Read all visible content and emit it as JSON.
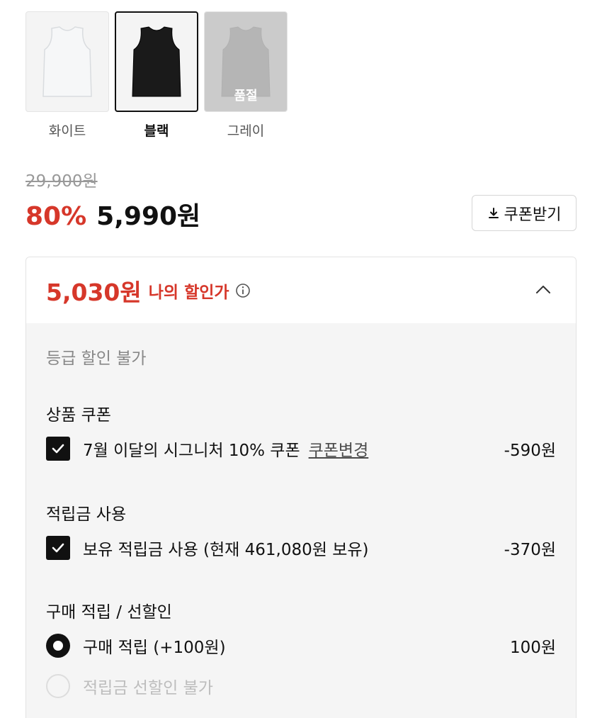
{
  "colors": {
    "accent_red": "#d6372a",
    "text_dark": "#111111",
    "panel_bg": "#f5f5f5"
  },
  "swatches": [
    {
      "label": "화이트",
      "color": "#f6f7f8",
      "selected": false,
      "sold_out": false
    },
    {
      "label": "블랙",
      "color": "#1a1a1a",
      "selected": true,
      "sold_out": false
    },
    {
      "label": "그레이",
      "color": "#9a9a9a",
      "selected": false,
      "sold_out": true,
      "sold_out_label": "품절"
    }
  ],
  "price": {
    "original": "29,900원",
    "discount_rate": "80%",
    "sale": "5,990원"
  },
  "coupon_button": {
    "label": "쿠폰받기",
    "icon": "download-icon"
  },
  "my_discount": {
    "price": "5,030원",
    "label": "나의 할인가",
    "info_icon": "info-icon",
    "toggle_icon": "chevron-up-icon",
    "grade_note": "등급 할인 불가",
    "product_coupon": {
      "title": "상품 쿠폰",
      "item_label": "7월 이달의 시그니처 10% 쿠폰",
      "change_link": "쿠폰변경",
      "amount": "-590원",
      "checked": true
    },
    "points_use": {
      "title": "적립금 사용",
      "item_label": "보유 적립금 사용 (현재 461,080원 보유)",
      "amount": "-370원",
      "checked": true
    },
    "purchase_points": {
      "title": "구매 적립 / 선할인",
      "option_on_label": "구매 적립 (+100원)",
      "option_on_amount": "100원",
      "option_off_label": "적립금 선할인 불가"
    }
  }
}
